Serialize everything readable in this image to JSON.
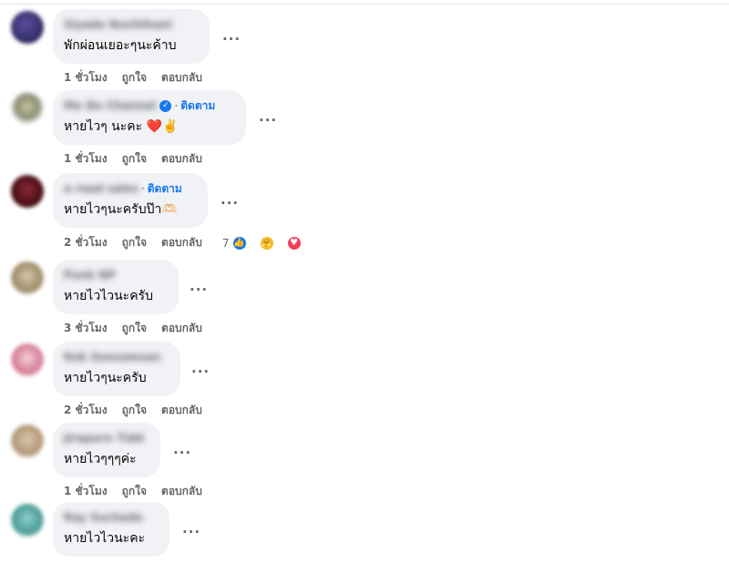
{
  "colors": {
    "bubble": "#f0f2f5",
    "secondary_text": "#65676b",
    "link_blue": "#1877f2",
    "like_blue": "#1877f2",
    "care_yellow": "#f7b928",
    "love_red": "#f33e58"
  },
  "more_label": "...",
  "reply_label": "ตอบกลับ",
  "like_label": "ถูกใจ",
  "comments": [
    {
      "name": "Siyada Nuchthani",
      "text": "พักผ่อนเยอะๆนะค้าบ",
      "time": "1 ชั่วโมง",
      "avatar_color": "#3a2f6b"
    },
    {
      "name": "Me Do Channel",
      "verified": true,
      "follow": "ติดตาม",
      "text": "หายไวๆ นะคะ ❤️✌️",
      "time": "1 ชั่วโมง",
      "avatar_color": "#8c8f74"
    },
    {
      "name": "a road sales",
      "follow": "ติดตาม",
      "text": "หายไวๆนะครับป๊า🫶🏻",
      "time": "2 ชั่วโมง",
      "reaction_count": "7",
      "reaction_icons": [
        "like-icon",
        "care-icon",
        "love-icon"
      ],
      "avatar_color": "#5a1420"
    },
    {
      "name": "Punk NP",
      "text": "หายไวไวนะครับ",
      "time": "3 ชั่วโมง",
      "avatar_color": "#a08e6c"
    },
    {
      "name": "Kok Sonsomsan",
      "text": "หายไวๆนะครับ",
      "time": "2 ชั่วโมง",
      "avatar_color": "#d67f98"
    },
    {
      "name": "Jiraporn Tidd",
      "text": "หายไวๆๆๆค่ะ",
      "time": "1 ชั่วโมง",
      "avatar_color": "#b39a7a"
    },
    {
      "name": "Ray Suchada",
      "text": "หายไวไวนะคะ",
      "avatar_color": "#4e9d9a"
    }
  ]
}
